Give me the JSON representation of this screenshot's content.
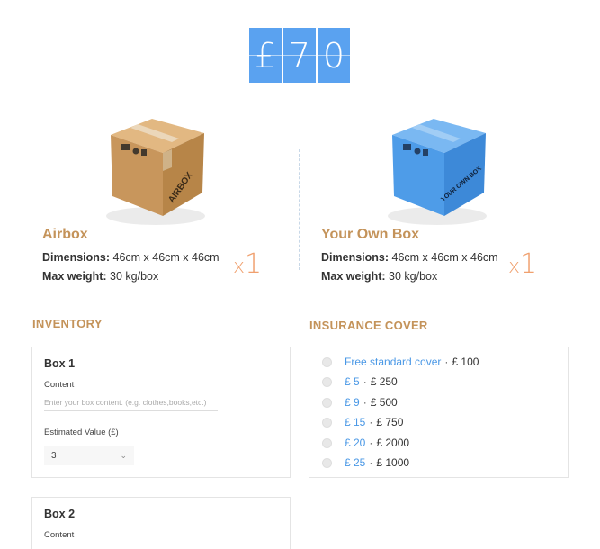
{
  "price": {
    "digits": [
      "£",
      "7",
      "0"
    ]
  },
  "boxes": [
    {
      "title": "Airbox",
      "dim_label": "Dimensions:",
      "dim_value": " 46cm x 46cm x 46cm",
      "weight_label": "Max weight:",
      "weight_value": " 30 kg/box",
      "qty_x": "x",
      "qty_n": "1",
      "box_label": "AIRBOX",
      "color": "#cf9f64"
    },
    {
      "title": "Your Own Box",
      "dim_label": "Dimensions:",
      "dim_value": " 46cm x 46cm x 46cm",
      "weight_label": "Max weight:",
      "weight_value": " 30 kg/box",
      "qty_x": "x",
      "qty_n": "1",
      "box_label": "YOUR OWN BOX",
      "color": "#55a4ee"
    }
  ],
  "inventory": {
    "title": "INVENTORY",
    "cards": [
      {
        "title": "Box 1",
        "content_label": "Content",
        "content_placeholder": "Enter your box content. (e.g. clothes,books,etc.)",
        "value_label": "Estimated Value (£)",
        "value_selected": "3"
      },
      {
        "title": "Box 2",
        "content_label": "Content"
      }
    ]
  },
  "insurance": {
    "title": "INSURANCE COVER",
    "options": [
      {
        "label": "Free standard cover",
        "sep": "·",
        "amount": "£ 100"
      },
      {
        "label": "£ 5",
        "sep": "·",
        "amount": "£ 250"
      },
      {
        "label": "£ 9",
        "sep": "·",
        "amount": "£ 500"
      },
      {
        "label": "£ 15",
        "sep": "·",
        "amount": "£ 750"
      },
      {
        "label": "£ 20",
        "sep": "·",
        "amount": "£ 2000"
      },
      {
        "label": "£ 25",
        "sep": "·",
        "amount": "£ 1000"
      }
    ]
  },
  "colors": {
    "accent_blue": "#5aa2f0",
    "title_gold": "#c4935a",
    "qty_orange": "#f0a06e",
    "link_blue": "#4a98e6"
  }
}
